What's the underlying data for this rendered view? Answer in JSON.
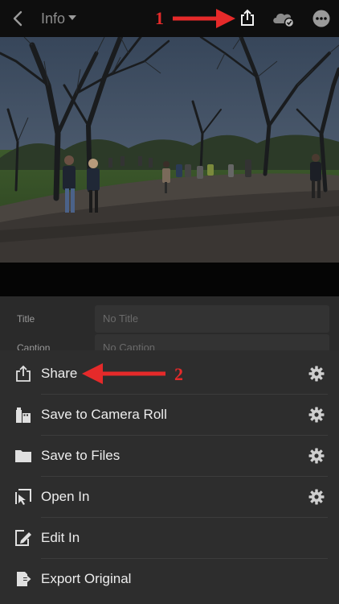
{
  "header": {
    "title": "Info"
  },
  "annotations": {
    "step1": "1",
    "step2": "2"
  },
  "metadata": {
    "title_label": "Title",
    "title_placeholder": "No Title",
    "caption_label": "Caption",
    "caption_placeholder": "No Caption"
  },
  "share_menu": {
    "items": [
      {
        "label": "Share",
        "icon": "share-icon",
        "has_settings": true
      },
      {
        "label": "Save to Camera Roll",
        "icon": "camera-roll-icon",
        "has_settings": true
      },
      {
        "label": "Save to Files",
        "icon": "folder-icon",
        "has_settings": true
      },
      {
        "label": "Open In",
        "icon": "open-in-icon",
        "has_settings": true
      },
      {
        "label": "Edit In",
        "icon": "edit-in-icon",
        "has_settings": false
      },
      {
        "label": "Export Original",
        "icon": "export-original-icon",
        "has_settings": false
      }
    ]
  },
  "colors": {
    "annotation_red": "#e52a2a",
    "sheet_bg": "#2d2d2d",
    "text": "#ededed"
  }
}
